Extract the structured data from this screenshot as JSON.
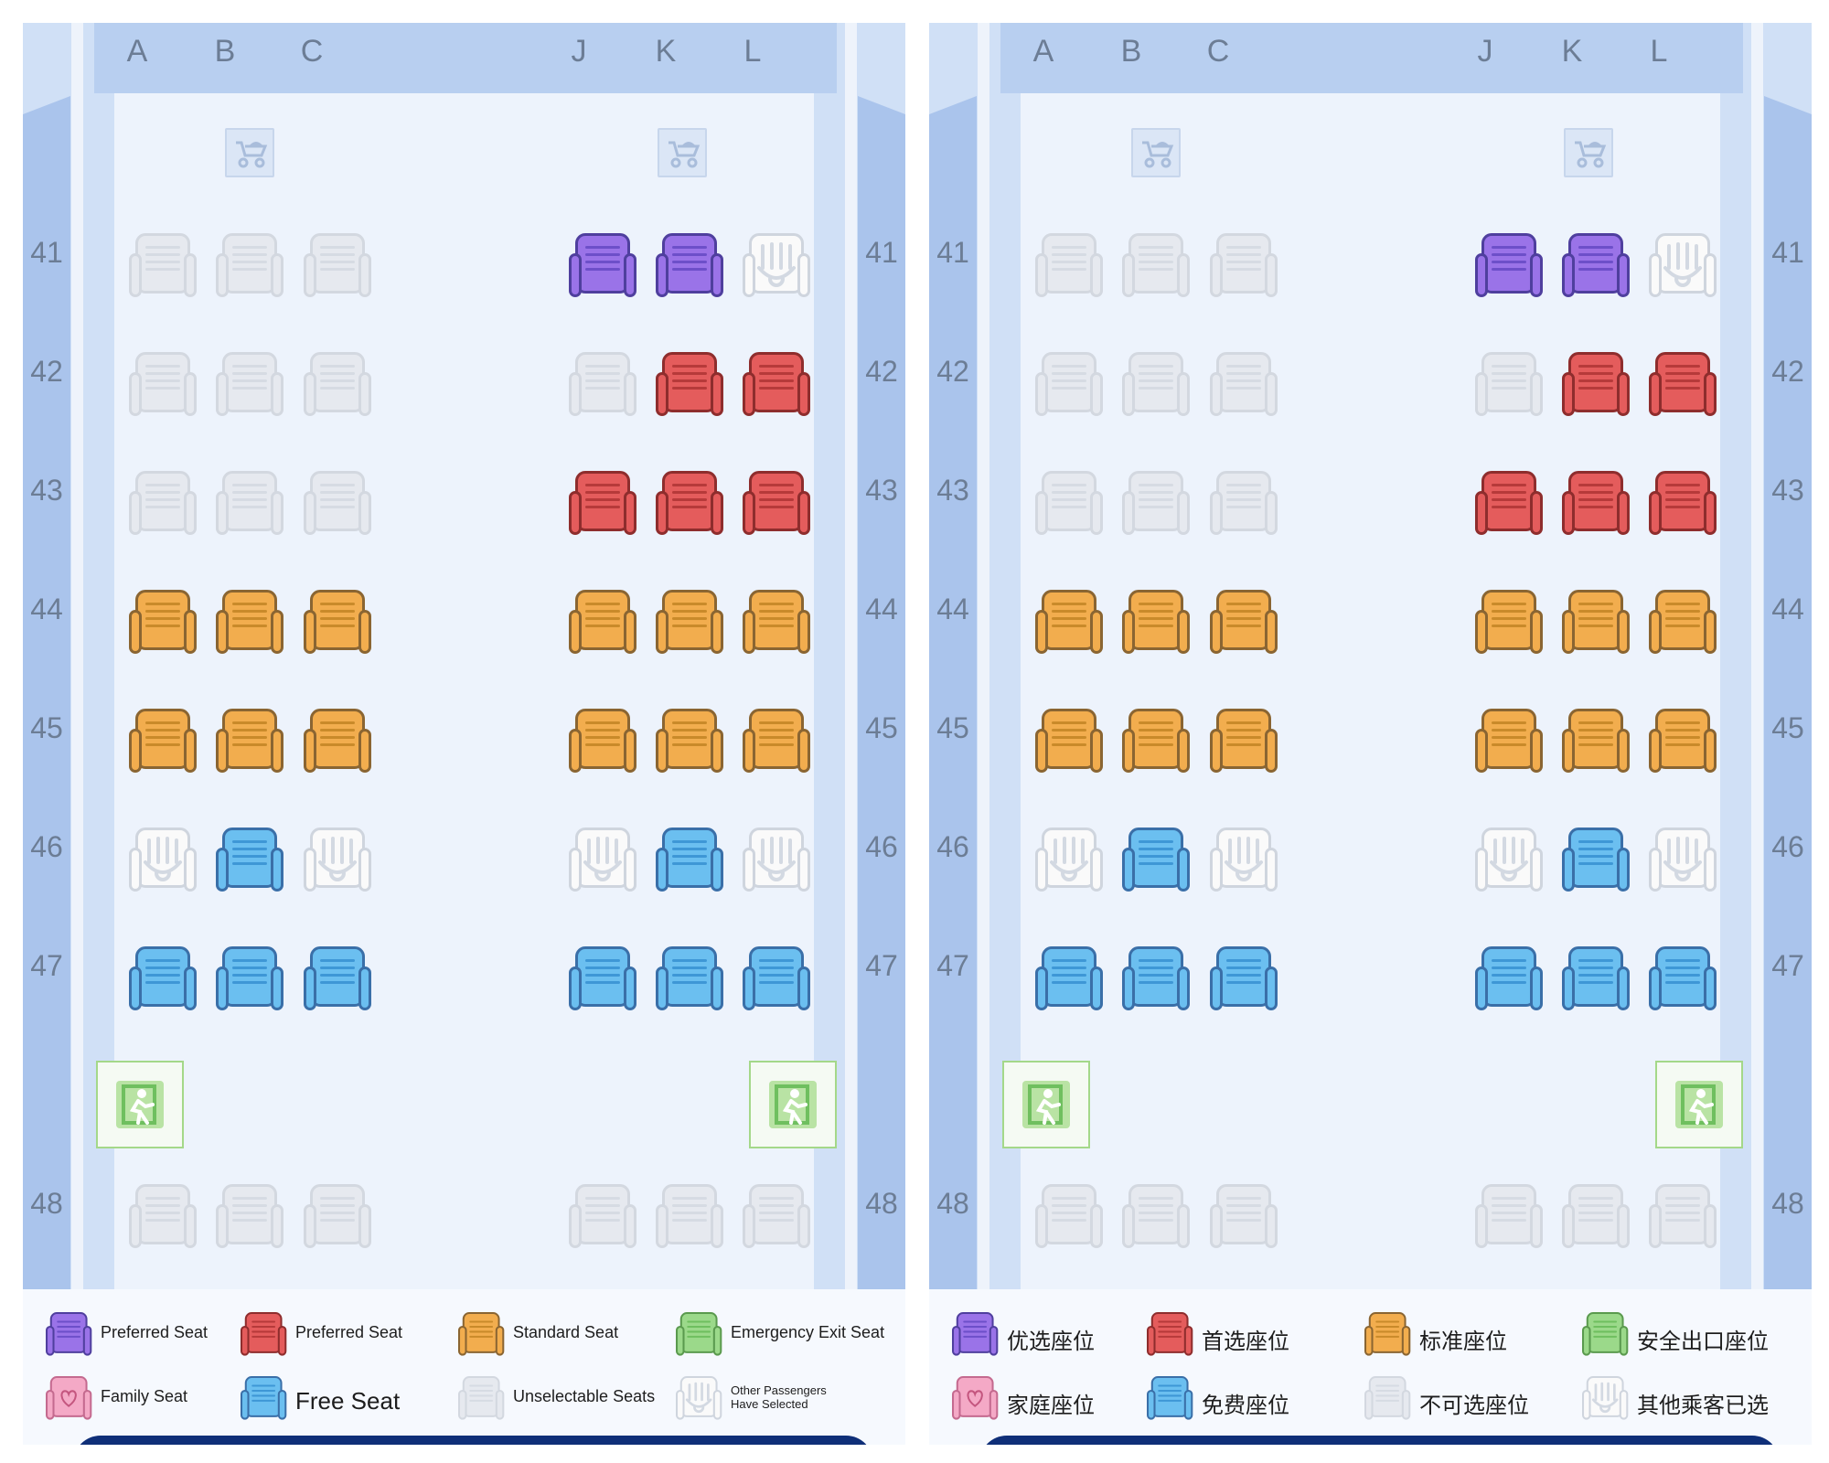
{
  "panels": [
    {
      "language": "en",
      "columns": [
        "A",
        "B",
        "C",
        "J",
        "K",
        "L"
      ],
      "rows": [
        {
          "label": "41",
          "seats": [
            "unselectable",
            "unselectable",
            "unselectable",
            "preferred_purple",
            "preferred_purple",
            "occupied"
          ]
        },
        {
          "label": "42",
          "seats": [
            "unselectable",
            "unselectable",
            "unselectable",
            "unselectable",
            "preferred_red",
            "preferred_red"
          ]
        },
        {
          "label": "43",
          "seats": [
            "unselectable",
            "unselectable",
            "unselectable",
            "preferred_red",
            "preferred_red",
            "preferred_red"
          ]
        },
        {
          "label": "44",
          "seats": [
            "standard",
            "standard",
            "standard",
            "standard",
            "standard",
            "standard"
          ]
        },
        {
          "label": "45",
          "seats": [
            "standard",
            "standard",
            "standard",
            "standard",
            "standard",
            "standard"
          ]
        },
        {
          "label": "46",
          "seats": [
            "occupied",
            "free",
            "occupied",
            "occupied",
            "free",
            "occupied"
          ]
        },
        {
          "label": "47",
          "seats": [
            "free",
            "free",
            "free",
            "free",
            "free",
            "free"
          ]
        },
        {
          "label": "48",
          "seats": [
            "unselectable",
            "unselectable",
            "unselectable",
            "unselectable",
            "unselectable",
            "unselectable"
          ]
        }
      ],
      "legend": [
        {
          "type": "preferred_purple",
          "label": "Preferred Seat"
        },
        {
          "type": "preferred_red",
          "label": "Preferred Seat"
        },
        {
          "type": "standard",
          "label": "Standard Seat"
        },
        {
          "type": "exit",
          "label": "Emergency Exit Seat"
        },
        {
          "type": "family",
          "label": "Family Seat"
        },
        {
          "type": "free",
          "label": "Free Seat"
        },
        {
          "type": "unselectable",
          "label": "Unselectable Seats"
        },
        {
          "type": "occupied",
          "label": "Other Passengers Have Selected"
        }
      ]
    },
    {
      "language": "zh",
      "columns": [
        "A",
        "B",
        "C",
        "J",
        "K",
        "L"
      ],
      "rows": [
        {
          "label": "41",
          "seats": [
            "unselectable",
            "unselectable",
            "unselectable",
            "preferred_purple",
            "preferred_purple",
            "occupied"
          ]
        },
        {
          "label": "42",
          "seats": [
            "unselectable",
            "unselectable",
            "unselectable",
            "unselectable",
            "preferred_red",
            "preferred_red"
          ]
        },
        {
          "label": "43",
          "seats": [
            "unselectable",
            "unselectable",
            "unselectable",
            "preferred_red",
            "preferred_red",
            "preferred_red"
          ]
        },
        {
          "label": "44",
          "seats": [
            "standard",
            "standard",
            "standard",
            "standard",
            "standard",
            "standard"
          ]
        },
        {
          "label": "45",
          "seats": [
            "standard",
            "standard",
            "standard",
            "standard",
            "standard",
            "standard"
          ]
        },
        {
          "label": "46",
          "seats": [
            "occupied",
            "free",
            "occupied",
            "occupied",
            "free",
            "occupied"
          ]
        },
        {
          "label": "47",
          "seats": [
            "free",
            "free",
            "free",
            "free",
            "free",
            "free"
          ]
        },
        {
          "label": "48",
          "seats": [
            "unselectable",
            "unselectable",
            "unselectable",
            "unselectable",
            "unselectable",
            "unselectable"
          ]
        }
      ],
      "legend": [
        {
          "type": "preferred_purple",
          "label": "优选座位"
        },
        {
          "type": "preferred_red",
          "label": "首选座位"
        },
        {
          "type": "standard",
          "label": "标准座位"
        },
        {
          "type": "exit",
          "label": "安全出口座位"
        },
        {
          "type": "family",
          "label": "家庭座位"
        },
        {
          "type": "free",
          "label": "免费座位"
        },
        {
          "type": "unselectable",
          "label": "不可选座位"
        },
        {
          "type": "occupied",
          "label": "其他乘客已选"
        }
      ]
    }
  ],
  "seat_colors": {
    "preferred_purple": {
      "fill": "#9a73e8",
      "border": "#4f3f9e",
      "line": "#6d4fc9"
    },
    "preferred_red": {
      "fill": "#e45c5c",
      "border": "#8e2d2d",
      "line": "#b63a3a"
    },
    "standard": {
      "fill": "#f2ad4e",
      "border": "#8a6532",
      "line": "#c98a2a"
    },
    "free": {
      "fill": "#6bbff0",
      "border": "#3a6fa8",
      "line": "#3e97d6"
    },
    "unselectable": {
      "fill": "#e6e9ef",
      "border": "#d3d8e0",
      "line": "#d6dbe3"
    },
    "exit": {
      "fill": "#9bd98a",
      "border": "#5a9a4e",
      "line": "#6fbf5f"
    },
    "family": {
      "fill": "#f4a9c6",
      "border": "#c46a8f",
      "line": "#e27aa3"
    },
    "occupied": {
      "fill": "#fafafa",
      "border": "#cfd5de",
      "line": "#d8dde5"
    }
  },
  "icons": {
    "stroller": "stroller-icon",
    "exit": "emergency-exit-icon",
    "family": "heart-icon"
  }
}
